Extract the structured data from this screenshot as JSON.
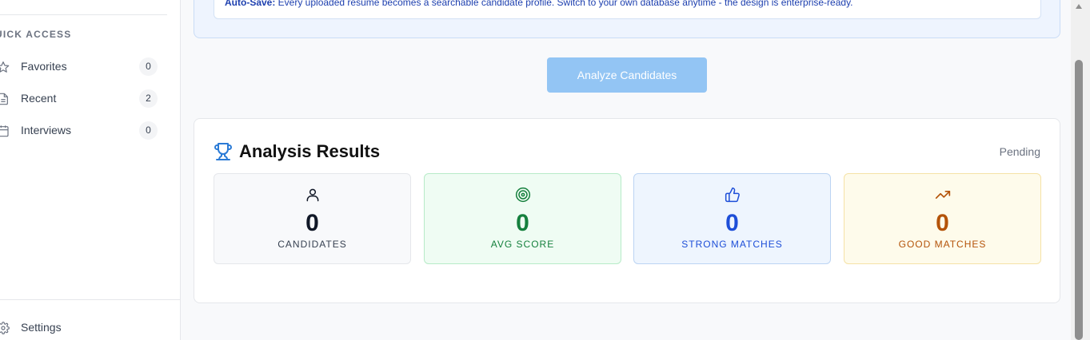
{
  "sidebar": {
    "section_heading": "UICK ACCESS",
    "items": [
      {
        "label": "Favorites",
        "count": "0",
        "icon": "star-icon"
      },
      {
        "label": "Recent",
        "count": "2",
        "icon": "document-icon"
      },
      {
        "label": "Interviews",
        "count": "0",
        "icon": "calendar-icon"
      }
    ],
    "settings_label": "Settings"
  },
  "info_banner": {
    "bold": "Auto-Save:",
    "text": " Every uploaded resume becomes a searchable candidate profile. Switch to your own database anytime - the design is enterprise-ready."
  },
  "analyze_button": {
    "label": "Analyze Candidates",
    "disabled": true
  },
  "results": {
    "title": "Analysis Results",
    "status": "Pending",
    "stats": [
      {
        "value": "0",
        "label": "CANDIDATES",
        "icon": "user-icon",
        "color": "#111827"
      },
      {
        "value": "0",
        "label": "AVG SCORE",
        "icon": "target-icon",
        "color": "#15803d"
      },
      {
        "value": "0",
        "label": "STRONG MATCHES",
        "icon": "thumbs-up-icon",
        "color": "#1d4ed8"
      },
      {
        "value": "0",
        "label": "GOOD MATCHES",
        "icon": "trending-up-icon",
        "color": "#b45309"
      }
    ]
  },
  "colors": {
    "accent": "#2b7bd6",
    "button_disabled": "#93c5f4"
  }
}
